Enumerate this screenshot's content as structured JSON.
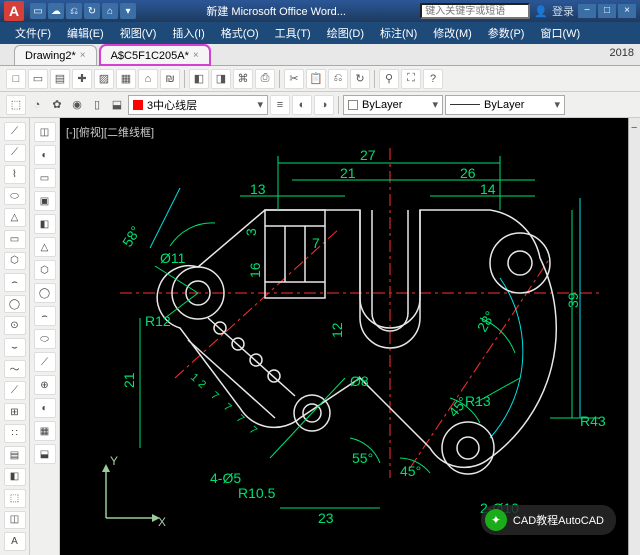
{
  "title_bar": {
    "app_logo_text": "A",
    "window_title": "新建 Microsoft Office Word...",
    "search_placeholder": "键入关键字或短语",
    "login_text": "登录"
  },
  "quick_access": [
    "▭",
    "☁",
    "⎌",
    "↻",
    "⌂",
    "▾"
  ],
  "win_buttons": {
    "min": "−",
    "max": "□",
    "close": "×"
  },
  "menus": [
    {
      "label": "文件(F)"
    },
    {
      "label": "编辑(E)"
    },
    {
      "label": "视图(V)"
    },
    {
      "label": "插入(I)"
    },
    {
      "label": "格式(O)"
    },
    {
      "label": "工具(T)"
    },
    {
      "label": "绘图(D)"
    },
    {
      "label": "标注(N)"
    },
    {
      "label": "修改(M)"
    },
    {
      "label": "参数(P)"
    },
    {
      "label": "窗口(W)"
    }
  ],
  "tabs": [
    {
      "label": "Drawing2*",
      "active": false,
      "highlighted": false
    },
    {
      "label": "A$C5F1C205A*",
      "active": true,
      "highlighted": true
    }
  ],
  "toolbar1_icons": [
    "□",
    "▭",
    "▤",
    "✚",
    "▨",
    "▦",
    "⌂",
    "₪",
    "◧",
    "◨",
    "⌘",
    "⎙",
    "✂",
    "📋",
    "⎌",
    "↻",
    "⚲",
    "⛶",
    "?"
  ],
  "toolbar1_year": "2018",
  "layer_panel": {
    "icons": [
      "⬚",
      "◔",
      "✿",
      "◉",
      "▯",
      "⬓"
    ],
    "current_layer": "3中心线层",
    "bylayer1_label": "ByLayer",
    "linetype_label": "ByLayer",
    "extra_icons": [
      "≡",
      "◐",
      "◑"
    ]
  },
  "left_toolbar": [
    "⟋",
    "⟋",
    "⌇",
    "⬭",
    "△",
    "▭",
    "⬡",
    "⌢",
    "◯",
    "⊙",
    "⌣",
    "～",
    "⟋",
    "⊞",
    "∷",
    "▤",
    "◧",
    "⬚",
    "◫",
    "A"
  ],
  "left_toolbar2": [
    "◫",
    "◐",
    "▭",
    "▣",
    "◧",
    "△",
    "⬡",
    "◯",
    "⌢",
    "⬭",
    "⟋",
    "⊕",
    "◐",
    "▦",
    "⬓"
  ],
  "canvas": {
    "view_label": "[-][俯视][二维线框]",
    "ucs_x": "X",
    "ucs_y": "Y",
    "badge_text": "CAD教程AutoCAD",
    "badge_icon": "✦"
  },
  "right_panel": {
    "neg": "−"
  },
  "drawing": {
    "dims_green": {
      "d27": "27",
      "d21": "21",
      "d13": "13",
      "d26": "26",
      "d14": "14",
      "d39": "39",
      "d3": "3",
      "d7": "7",
      "d16": "16",
      "d12": "12",
      "d21v": "21",
      "d23": "23",
      "r12": "R12",
      "r10_5": "R10.5",
      "r13": "R13",
      "r43": "R43",
      "phi11": "Ø11",
      "phi8": "Ø8",
      "a58": "58°",
      "a28": "28°",
      "a55": "55°",
      "a45": "45°",
      "a45b": "45°",
      "seq": "12 7 7 7 7",
      "note4phi5": "4-Ø5",
      "note2phi10": "2-Ø10"
    }
  }
}
